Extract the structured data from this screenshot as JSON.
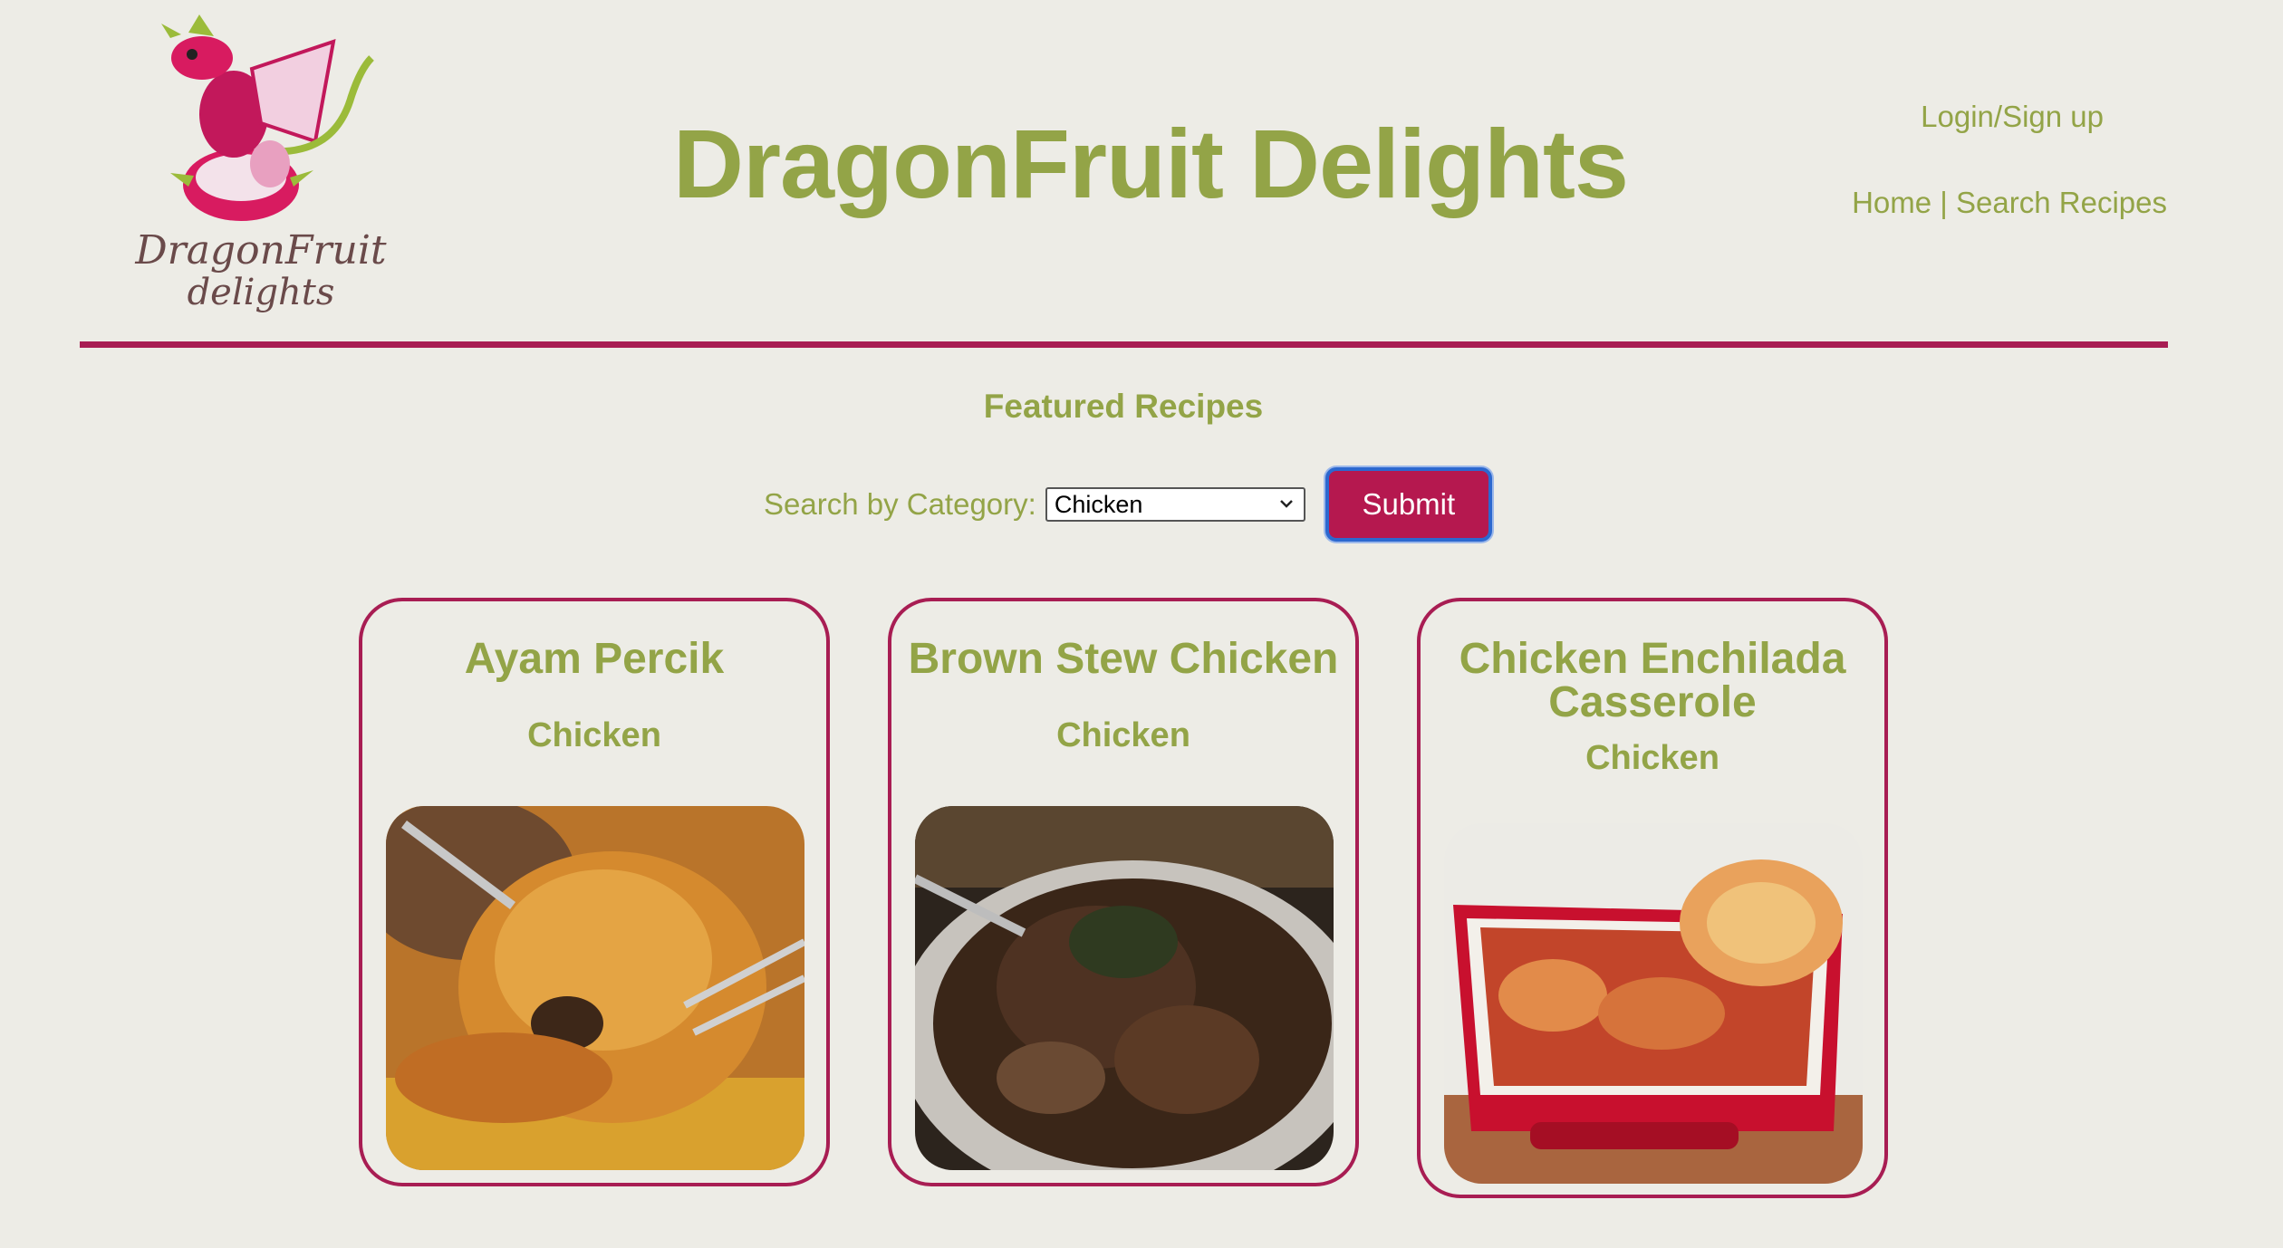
{
  "header": {
    "site_title": "DragonFruit Delights",
    "logo_text_line1": "DragonFruit",
    "logo_text_line2": "delights",
    "login_label": "Login/Sign up",
    "nav_home": "Home",
    "nav_separator": "|",
    "nav_search": "Search Recipes"
  },
  "search": {
    "heading": "Featured Recipes",
    "label": "Search by Category:",
    "selected_category": "Chicken",
    "submit_label": "Submit"
  },
  "recipes": [
    {
      "title": "Ayam Percik",
      "category": "Chicken",
      "image_icon": "fried-chicken-photo"
    },
    {
      "title": "Brown Stew Chicken",
      "category": "Chicken",
      "image_icon": "stew-photo"
    },
    {
      "title": "Chicken Enchilada Casserole",
      "category": "Chicken",
      "image_icon": "casserole-photo"
    }
  ],
  "colors": {
    "background": "#edece6",
    "accent_green": "#93a447",
    "accent_magenta": "#a81d53",
    "button": "#b5184f",
    "button_focus": "#2c68cf"
  }
}
